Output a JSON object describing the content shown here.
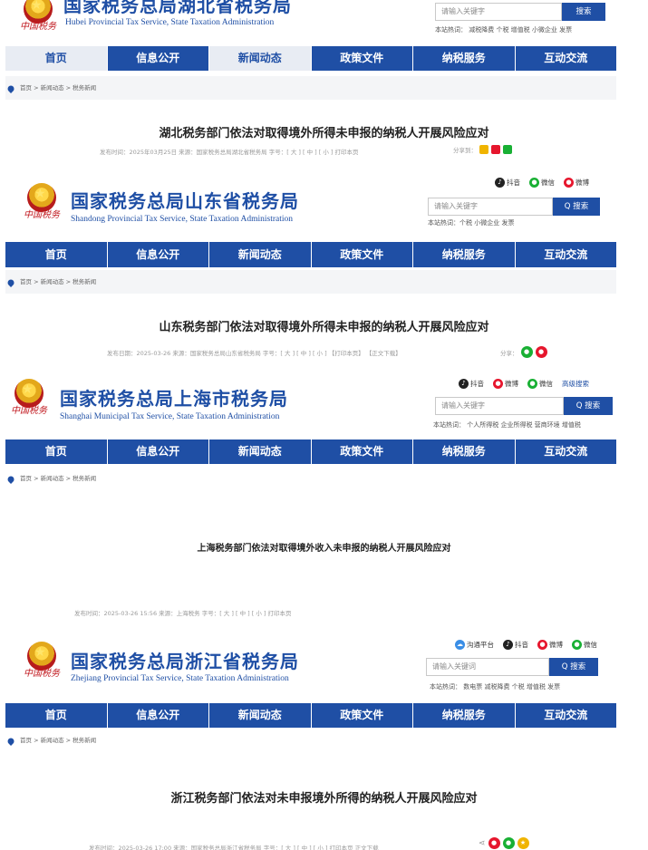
{
  "hubei": {
    "title_cn": "国家税务总局湖北省税务局",
    "title_en": "Hubei Provincial Tax Service, State Taxation Administration",
    "seal": "中国税务",
    "search_placeholder": "请输入关键字",
    "search_button": "搜索",
    "hot": "本站热词：  减税降费  个税  增值税  小微企业  发票",
    "nav": [
      "首页",
      "信息公开",
      "新闻动态",
      "政策文件",
      "纳税服务",
      "互动交流"
    ],
    "breadcrumb": "首页 > 新闻动态 > 税务新闻",
    "headline": "湖北税务部门依法对取得境外所得未申报的纳税人开展风险应对",
    "meta": "发布时间：2025年03月25日     来源：国家税务总局湖北省税务局     字号：[ 大 ] [ 中 ] [ 小 ]     打印本页",
    "share_label": "分享到："
  },
  "shandong": {
    "social": [
      "抖音",
      "微信",
      "微博"
    ],
    "title_cn": "国家税务总局山东省税务局",
    "title_en": "Shandong Provincial Tax Service, State Taxation Administration",
    "seal": "中国税务",
    "search_placeholder": "请输入关键字",
    "search_button": "Q 搜索",
    "hot": "本站热词：个税  小微企业  发票",
    "nav": [
      "首页",
      "信息公开",
      "新闻动态",
      "政策文件",
      "纳税服务",
      "互动交流"
    ],
    "breadcrumb": "首页 > 新闻动态 > 税务新闻",
    "headline": "山东税务部门依法对取得境外所得未申报的纳税人开展风险应对",
    "meta": "发布日期：2025-03-26   来源：国家税务总局山东省税务局   字号：[ 大 ] [ 中 ] [ 小 ]   【打印本页】   【正文下载】",
    "share_label": "分享："
  },
  "shanghai": {
    "social": [
      "抖音",
      "微博",
      "微信"
    ],
    "advanced": "高级搜索",
    "title_cn": "国家税务总局上海市税务局",
    "title_en": "Shanghai Municipal Tax Service, State Taxation Administration",
    "seal": "中国税务",
    "search_placeholder": "请输入关键字",
    "search_button": "Q 搜索",
    "hot": "本站热词：  个人所得税  企业所得税  营商环境  增值税",
    "nav": [
      "首页",
      "信息公开",
      "新闻动态",
      "政策文件",
      "纳税服务",
      "互动交流"
    ],
    "breadcrumb": "首页 > 新闻动态 > 税务新闻",
    "headline": "上海税务部门依法对取得境外收入未申报的纳税人开展风险应对",
    "meta": "发布时间：2025-03-26 15:56          来源：上海税务          字号：[ 大 ] [ 中 ] [ 小 ]          打印本页"
  },
  "zhejiang": {
    "social": [
      "沟通平台",
      "抖音",
      "微博",
      "微信"
    ],
    "title_cn": "国家税务总局浙江省税务局",
    "title_en": "Zhejiang Provincial Tax Service, State Taxation Administration",
    "seal": "中国税务",
    "search_placeholder": "请输入关键词",
    "search_button": "Q 搜索",
    "hot": "本站热词：  数电票  减税降费  个税  增值税  发票",
    "nav": [
      "首页",
      "信息公开",
      "新闻动态",
      "政策文件",
      "纳税服务",
      "互动交流"
    ],
    "breadcrumb": "首页 > 新闻动态 > 税务新闻",
    "headline": "浙江税务部门依法对未申报境外所得的纳税人开展风险应对",
    "meta": "发布时间：2025-03-26  17:00    来源：国家税务总局浙江省税务局    字号：[ 大 ] [ 中 ] [ 小 ]    打印本页    正文下载"
  },
  "colors": {
    "brand_blue": "#1f4fa5",
    "seal_red": "#c0161c",
    "wechat_green": "#19b034",
    "weibo_red": "#e6162d",
    "douyin_black": "#222222"
  }
}
